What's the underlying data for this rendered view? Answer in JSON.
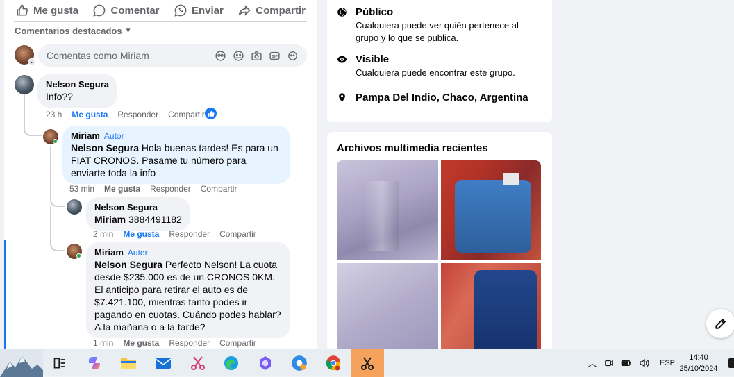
{
  "post_actions": {
    "like": "Me gusta",
    "comment": "Comentar",
    "send": "Enviar",
    "share": "Compartir"
  },
  "featured_label": "Comentarios destacados",
  "composer": {
    "placeholder": "Comentas como Miriam"
  },
  "comment_actions": {
    "like": "Me gusta",
    "reply": "Responder",
    "share": "Compartir"
  },
  "comments": [
    {
      "author": "Nelson Segura",
      "text": "Info??",
      "time": "23 h"
    },
    {
      "author": "Miriam",
      "tag": "Autor",
      "mention": "Nelson Segura",
      "text": " Hola buenas tardes! Es para un FIAT CRONOS. Pasame tu número para enviarte toda la info",
      "time": "53 min"
    },
    {
      "author": "Nelson Segura",
      "mention": "Miriam",
      "text": " 3884491182",
      "time": "2 min"
    },
    {
      "author": "Miriam",
      "tag": "Autor",
      "mention": "Nelson Segura",
      "text": " Perfecto Nelson! La cuota desde $235.000 es de un CRONOS 0KM. El anticipo para retirar el auto es de $7.421.100, mientras tanto podes ir pagando en cuotas. Cuándo podes hablar? A la mañana o a la tarde?",
      "time": "1 min"
    }
  ],
  "group_info": [
    {
      "icon": "globe-icon",
      "title": "Público",
      "subtitle": "Cualquiera puede ver quién pertenece al grupo y lo que se publica."
    },
    {
      "icon": "eye-icon",
      "title": "Visible",
      "subtitle": "Cualquiera puede encontrar este grupo."
    },
    {
      "icon": "location-pin-icon",
      "title": "Pampa Del Indio, Chaco, Argentina",
      "subtitle": ""
    }
  ],
  "media": {
    "title": "Archivos multimedia recientes"
  },
  "taskbar": {
    "language": "ESP",
    "time": "14:40",
    "date": "25/10/2024"
  },
  "colors": {
    "accent": "#1877f2",
    "taskbar_active": "#f5a35c"
  }
}
